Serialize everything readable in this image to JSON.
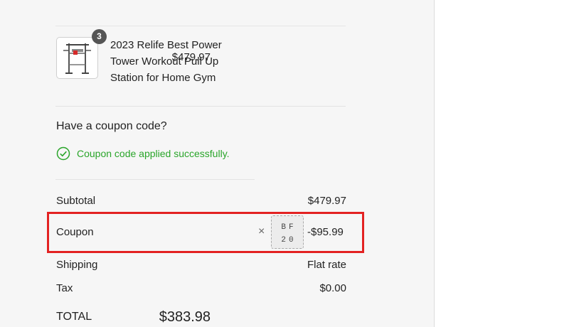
{
  "cart_item": {
    "quantity": "3",
    "name": "2023 Relife Best Power Tower Workout Pull Up Station for Home Gym",
    "price": "$479.97",
    "image_icon": "power-tower-icon"
  },
  "coupon": {
    "question": "Have a coupon code?",
    "success_message": "Coupon code applied successfully.",
    "success_icon": "check-circle-icon",
    "success_color": "#2aa52a",
    "code_line1": "BF",
    "code_line2": "20",
    "remove_symbol": "×"
  },
  "totals": {
    "subtotal_label": "Subtotal",
    "subtotal_value": "$479.97",
    "coupon_label": "Coupon",
    "coupon_value": "-$95.99",
    "shipping_label": "Shipping",
    "shipping_value": "Flat rate",
    "tax_label": "Tax",
    "tax_value": "$0.00",
    "total_label": "TOTAL",
    "total_value": "$383.98"
  },
  "highlight_color": "#e32222"
}
